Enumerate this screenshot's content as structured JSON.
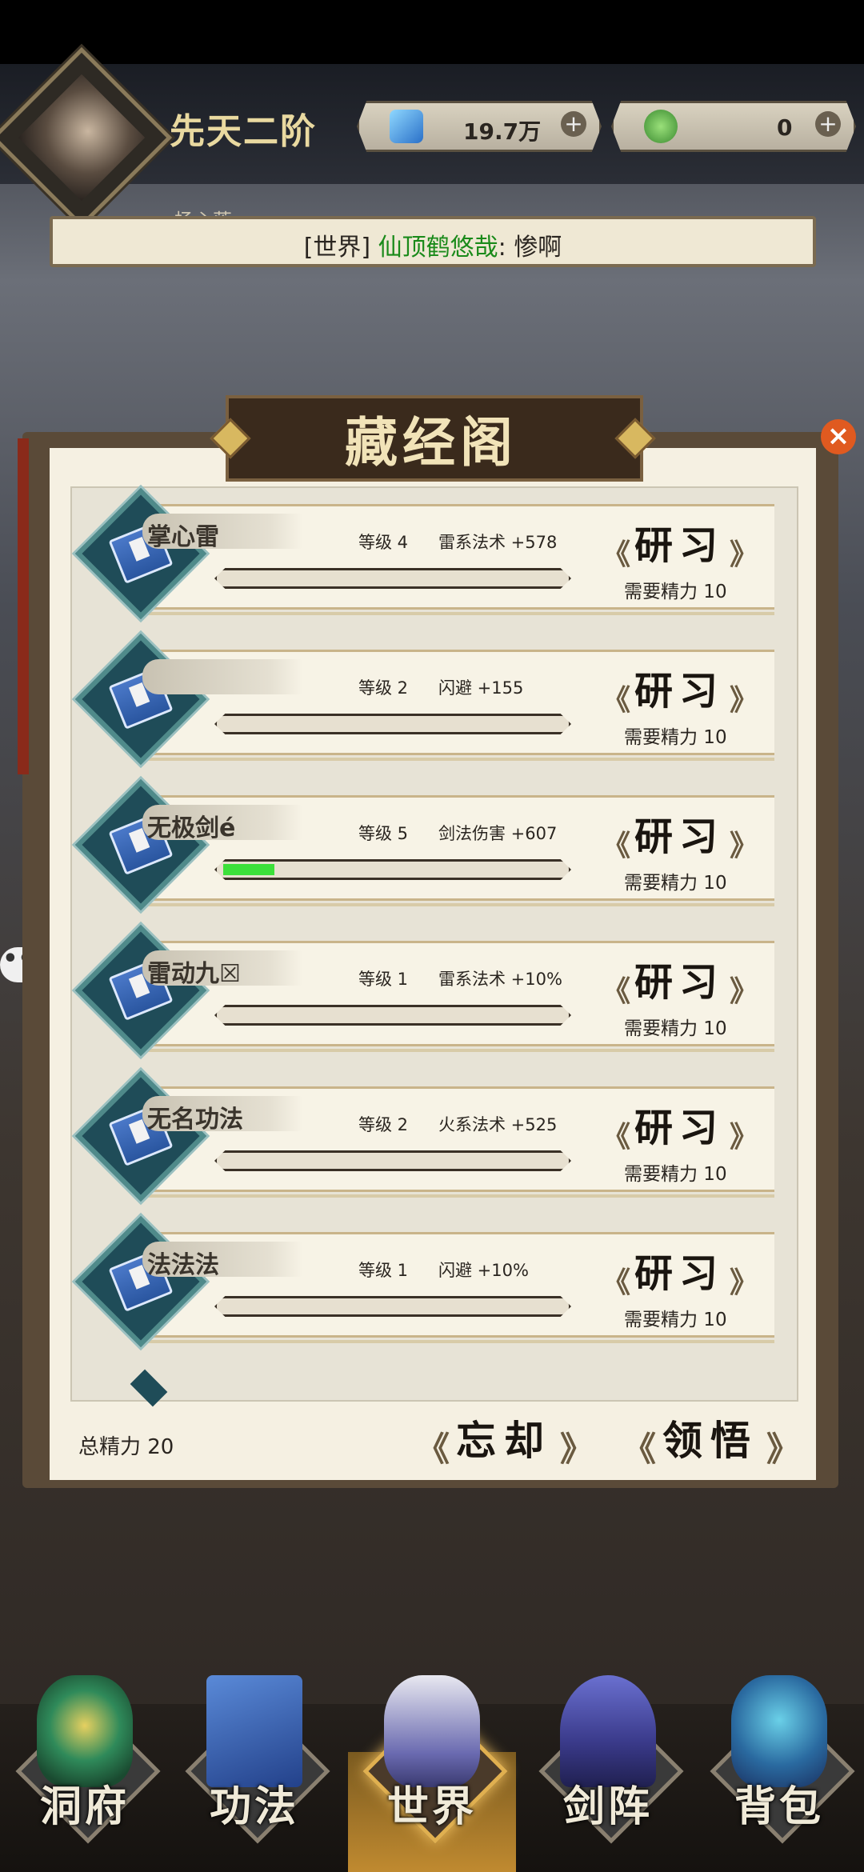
{
  "header": {
    "rank": "先天二阶",
    "player_name": "杨心落",
    "crystal": {
      "value": "19.7万",
      "plus": "+",
      "icon": "blue-crystal-icon",
      "color": "#3aa0e8"
    },
    "jade": {
      "value": "0",
      "plus": "+",
      "icon": "green-jade-icon",
      "color": "#5fb040"
    }
  },
  "world_chat": {
    "channel": "[世界]",
    "user": "仙顶鹤悠哉",
    "sep": ":",
    "message": "惨啊"
  },
  "panel": {
    "title": "藏经阁",
    "close": "×",
    "total_label": "总精力 20",
    "forget_label": "忘却",
    "comprehend_label": "领悟"
  },
  "skills": [
    {
      "name": "掌心雷",
      "level": "等级 4",
      "effect": "雷系法术 +578",
      "button": "研习",
      "cost": "需要精力 10",
      "progress": 0
    },
    {
      "name": "",
      "level": "等级 2",
      "effect": "闪避 +155",
      "button": "研习",
      "cost": "需要精力 10",
      "progress": 0
    },
    {
      "name": "无极剑é",
      "level": "等级 5",
      "effect": "剑法伤害 +607",
      "button": "研习",
      "cost": "需要精力 10",
      "progress": 0.15
    },
    {
      "name": "雷动九☒",
      "level": "等级 1",
      "effect": "雷系法术 +10%",
      "button": "研习",
      "cost": "需要精力 10",
      "progress": 0
    },
    {
      "name": "无名功法",
      "level": "等级 2",
      "effect": "火系法术 +525",
      "button": "研习",
      "cost": "需要精力 10",
      "progress": 0
    },
    {
      "name": "法法法",
      "level": "等级 1",
      "effect": "闪避 +10%",
      "button": "研习",
      "cost": "需要精力 10",
      "progress": 0
    }
  ],
  "chat_bubble": "•••",
  "nav": [
    {
      "label": "洞府",
      "icon": "cave-dwelling-icon"
    },
    {
      "label": "功法",
      "icon": "scripture-book-icon"
    },
    {
      "label": "世界",
      "icon": "world-mountain-icon"
    },
    {
      "label": "剑阵",
      "icon": "sword-array-icon"
    },
    {
      "label": "背包",
      "icon": "backpack-icon"
    }
  ]
}
